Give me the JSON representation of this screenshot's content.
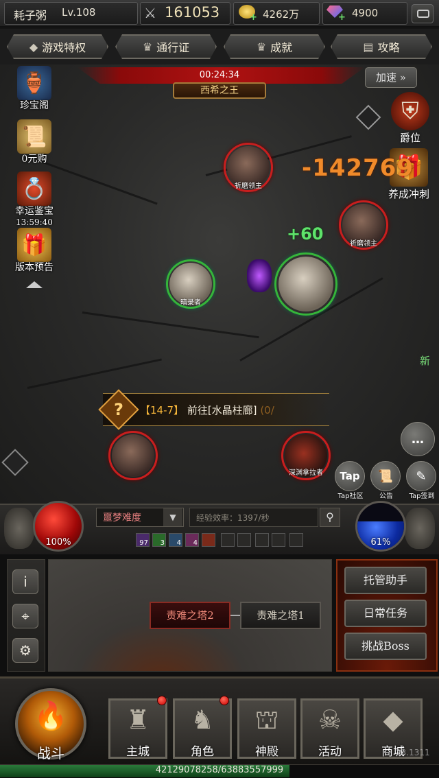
{
  "topbar": {
    "player_name": "耗子粥",
    "player_level": "Lv.108",
    "power": "161053",
    "gold": "4262万",
    "gems": "4900"
  },
  "tabs": [
    {
      "label": "游戏特权",
      "icon": "diamond-icon"
    },
    {
      "label": "通行证",
      "icon": "crown-icon"
    },
    {
      "label": "成就",
      "icon": "crown-icon"
    },
    {
      "label": "攻略",
      "icon": "book-icon"
    }
  ],
  "boss": {
    "timer": "00:24:34",
    "name": "西希之王"
  },
  "speed_button": "加速 »",
  "left_icons": [
    {
      "label": "珍宝阁",
      "sub": ""
    },
    {
      "label": "0元购",
      "sub": ""
    },
    {
      "label": "幸运鉴宝",
      "sub": "13:59:40"
    },
    {
      "label": "版本预告",
      "sub": ""
    }
  ],
  "right_icons": [
    {
      "label": "爵位"
    },
    {
      "label": "养成冲刺"
    }
  ],
  "units": {
    "enemy_top": "祈磨领主",
    "enemy_right": "祈磨领主",
    "ally_left": "暗录者",
    "enemy_bottom_left": "",
    "enemy_bottom_right": "深渊拿拉者"
  },
  "combat": {
    "damage": "-142769",
    "heal": "+60"
  },
  "quest": {
    "stage": "【14-7】",
    "text": "前往[水晶柱廊]",
    "progress": "(0/"
  },
  "round_buttons": [
    {
      "label": "Tap社区",
      "glyph": "Tap"
    },
    {
      "label": "公告",
      "glyph": "📜"
    },
    {
      "label": "Tap签到",
      "glyph": "✎"
    }
  ],
  "new_badge": "新",
  "hud": {
    "hp_percent": "100%",
    "mp_percent": "61%",
    "mp_level": 0.61,
    "difficulty": "噩梦难度",
    "xp_rate": "经验效率：1397/秒",
    "buffs": [
      "97",
      "3",
      "4",
      "4"
    ]
  },
  "panel": {
    "tower_2": "责难之塔2",
    "tower_1": "责难之塔1",
    "tasks": [
      "托管助手",
      "日常任务",
      "挑战Boss"
    ]
  },
  "nav": {
    "battle": "战斗",
    "items": [
      "主城",
      "角色",
      "神殿",
      "活动",
      "商城"
    ]
  },
  "exp": {
    "text": "42129078258/63883557999",
    "fraction": 0.66
  },
  "version": "23.1311"
}
